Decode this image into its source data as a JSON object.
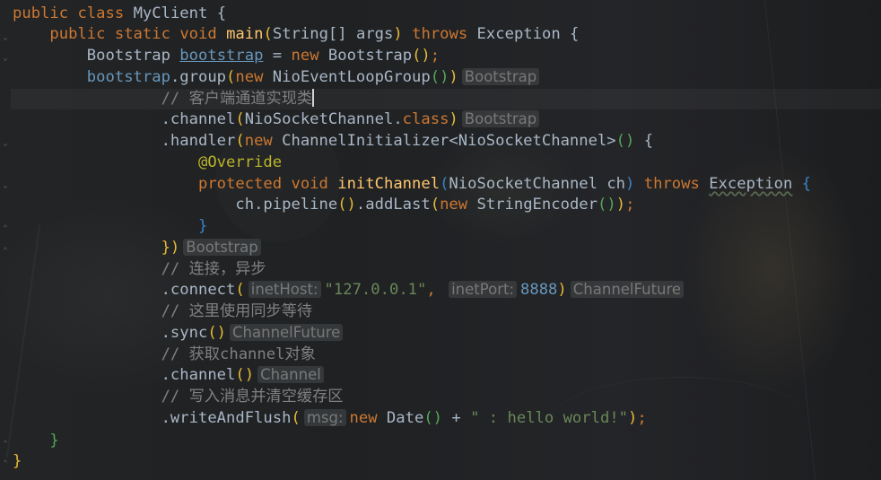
{
  "editor": {
    "theme": "Darcula",
    "colors": {
      "keyword": "#cc7832",
      "method": "#ffc66d",
      "annotation": "#bbb529",
      "string": "#6a8759",
      "number": "#6897bb",
      "comment": "#808080",
      "text": "#a9b7c6",
      "hint_bg": "#3a3c3e"
    },
    "lines": [
      {
        "kw1": "public",
        "kw2": "class",
        "name": "MyClient",
        "open": "{"
      },
      {
        "kw1": "public",
        "kw2": "static",
        "kw3": "void",
        "method": "main",
        "params": "String[] args",
        "kw4": "throws",
        "exception": "Exception",
        "open": "{"
      },
      {
        "type": "Bootstrap",
        "var": "bootstrap",
        "op": "=",
        "kw": "new",
        "ctor": "Bootstrap",
        "end": ";"
      },
      {
        "var": "bootstrap",
        "call": ".group",
        "kw": "new",
        "arg": "NioEventLoopGroup",
        "hint": "Bootstrap"
      },
      {
        "comment": "// 客户端通道实现类"
      },
      {
        "call": ".channel",
        "arg": "NioSocketChannel",
        "dot": ".",
        "kw": "class",
        "hint": "Bootstrap"
      },
      {
        "call": ".handler",
        "kw": "new",
        "arg": "ChannelInitializer<NioSocketChannel>",
        "open": "{"
      },
      {
        "annotation": "@Override"
      },
      {
        "kw1": "protected",
        "kw2": "void",
        "method": "initChannel",
        "params": "NioSocketChannel ch",
        "kw3": "throws",
        "exception": "Exception",
        "open": "{"
      },
      {
        "obj": "ch",
        "call1": ".pipeline",
        "call2": ".addLast",
        "kw": "new",
        "arg": "StringEncoder",
        "end": ";"
      },
      {
        "close": "}"
      },
      {
        "close": "})",
        "hint": "Bootstrap"
      },
      {
        "comment": "// 连接，异步"
      },
      {
        "call": ".connect",
        "hint1": "inetHost:",
        "string": "\"127.0.0.1\"",
        "comma": ",",
        "hint2": "inetPort:",
        "number": "8888",
        "hint": "ChannelFuture"
      },
      {
        "comment": "// 这里使用同步等待"
      },
      {
        "call": ".sync",
        "hint": "ChannelFuture"
      },
      {
        "comment": "// 获取channel对象"
      },
      {
        "call": ".channel",
        "hint": "Channel"
      },
      {
        "comment": "// 写入消息并清空缓存区"
      },
      {
        "call": ".writeAndFlush",
        "hint1": "msg:",
        "kw": "new",
        "ctor": "Date",
        "op": "+",
        "string": "\" : hello world!\"",
        "end": ";"
      },
      {
        "close": "}"
      },
      {
        "close": "}"
      }
    ]
  }
}
